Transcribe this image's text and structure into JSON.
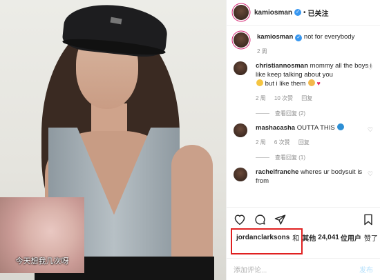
{
  "header": {
    "username": "kamiosman",
    "dot": "•",
    "follow_label": "已关注"
  },
  "caption": {
    "username": "kamiosman",
    "text": "not for everybody",
    "time": "2 周"
  },
  "comments": [
    {
      "username": "christiannosman",
      "text": "mommy all the boys i like keep talking about you",
      "text2": "but i like them",
      "time": "2 周",
      "likes": "10 次赞",
      "reply": "回复",
      "view_replies": "查看回复 (2)"
    },
    {
      "username": "mashacasha",
      "text": "OUTTA THIS",
      "time": "2 周",
      "likes": "6 次赞",
      "reply": "回复",
      "view_replies": "查看回复 (1)"
    },
    {
      "username": "rachelfranche",
      "text": "wheres ur bodysuit is from",
      "time": "",
      "likes": "",
      "reply": "",
      "view_replies": ""
    }
  ],
  "likes": {
    "liker": "jordanclarksons",
    "and": "和",
    "others": "其他",
    "count": "24,041",
    "unit": "位用户",
    "liked": "赞了"
  },
  "add_comment": {
    "placeholder": "添加评论...",
    "post_label": "发布"
  },
  "inset": {
    "caption": "今天想我几次呀"
  },
  "colors": {
    "verified": "#3897f0",
    "highlight_box": "#e02020",
    "story_ring": "#d62976"
  }
}
